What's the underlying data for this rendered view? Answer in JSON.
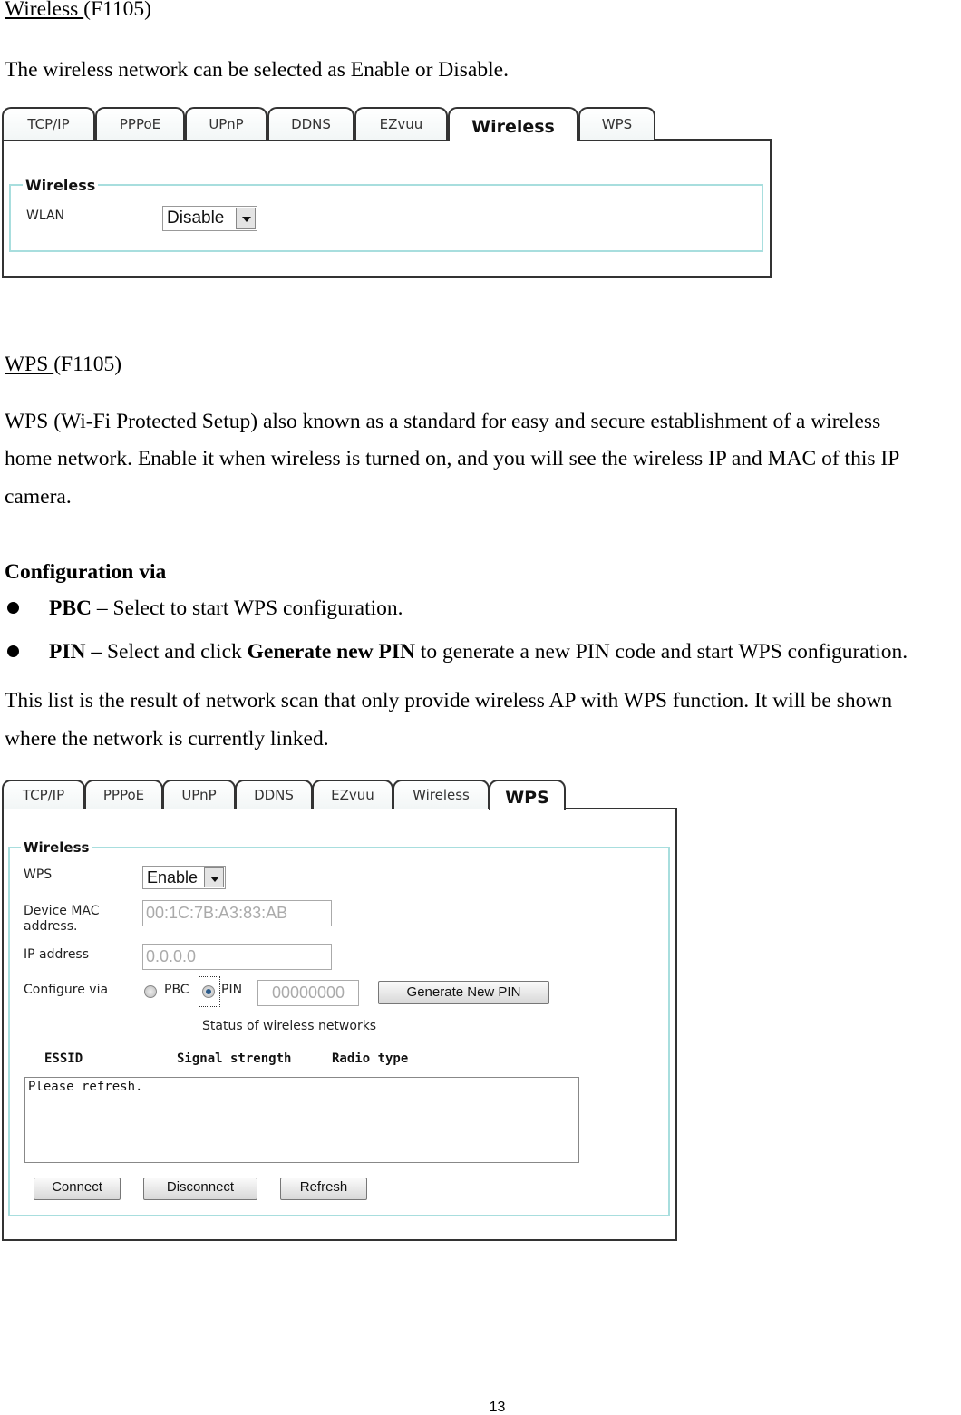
{
  "section1": {
    "heading": "Wireless ",
    "heading_model": "(F1105)",
    "description": "The wireless network can be selected as Enable or Disable.",
    "screenshot": {
      "tabs": [
        "TCP/IP",
        "PPPoE",
        "UPnP",
        "DDNS",
        "EZvuu",
        "Wireless",
        "WPS"
      ],
      "active_tab": "Wireless",
      "fieldset_legend": "Wireless",
      "wlan_label": "WLAN",
      "wlan_value": "Disable"
    }
  },
  "section2": {
    "heading": "WPS ",
    "heading_model": "(F1105)",
    "paragraph_lines": [
      "WPS (Wi-Fi Protected Setup) also known as a standard for easy and secure establishment of a wireless",
      "home network. Enable it when wireless is turned on, and you will see the wireless IP and MAC of this IP",
      "camera."
    ],
    "config_heading": "Configuration via",
    "bullets": [
      {
        "term": "PBC",
        "text": " – Select to start WPS configuration."
      },
      {
        "term": "PIN",
        "text": " – Select and click ",
        "bold2": "Generate new PIN",
        "text2": " to generate a new PIN code and start WPS configuration."
      }
    ],
    "list_lines": [
      "This list is the result of network scan that only provide wireless AP with WPS function. It will be shown",
      "where the network is currently linked."
    ],
    "screenshot": {
      "tabs": [
        "TCP/IP",
        "PPPoE",
        "UPnP",
        "DDNS",
        "EZvuu",
        "Wireless",
        "WPS"
      ],
      "active_tab": "WPS",
      "fieldset_legend": "Wireless",
      "wps_label": "WPS",
      "wps_value": "Enable",
      "mac_label_1": "Device MAC",
      "mac_label_2": "address.",
      "mac_value": "00:1C:7B:A3:83:AB",
      "ip_label": "IP address",
      "ip_value": "0.0.0.0",
      "configure_label": "Configure via",
      "pbc_label": "PBC",
      "pin_label": "PIN",
      "pin_selected": true,
      "pin_value": "00000000",
      "generate_button": "Generate New PIN",
      "status_title": "Status of wireless networks",
      "columns": [
        "ESSID",
        "Signal strength",
        "Radio type"
      ],
      "list_text": "Please refresh.",
      "buttons": [
        "Connect",
        "Disconnect",
        "Refresh"
      ]
    }
  },
  "page_number": "13"
}
